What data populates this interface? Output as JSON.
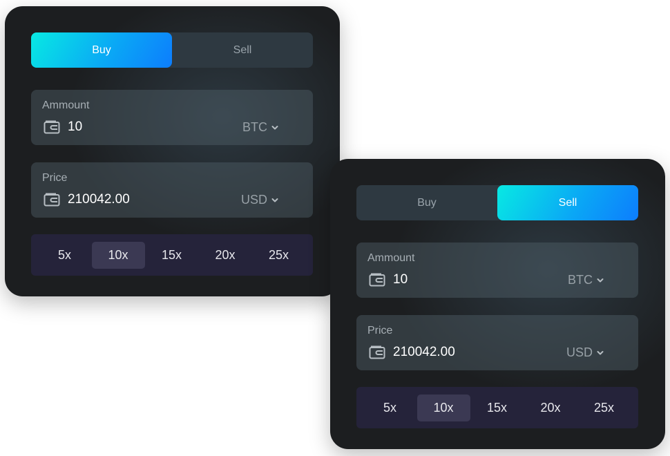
{
  "cards": [
    {
      "tabs": {
        "buy": "Buy",
        "sell": "Sell",
        "active": "buy"
      },
      "amount": {
        "label": "Ammount",
        "value": "10",
        "currency": "BTC"
      },
      "price": {
        "label": "Price",
        "value": "210042.00",
        "currency": "USD"
      },
      "leverage": {
        "options": [
          "5x",
          "10x",
          "15x",
          "20x",
          "25x"
        ],
        "selected": "10x"
      }
    },
    {
      "tabs": {
        "buy": "Buy",
        "sell": "Sell",
        "active": "sell"
      },
      "amount": {
        "label": "Ammount",
        "value": "10",
        "currency": "BTC"
      },
      "price": {
        "label": "Price",
        "value": "210042.00",
        "currency": "USD"
      },
      "leverage": {
        "options": [
          "5x",
          "10x",
          "15x",
          "20x",
          "25x"
        ],
        "selected": "10x"
      }
    }
  ],
  "icons": {
    "field": "wallet-icon",
    "dropdown": "chevron-down-icon"
  },
  "colors": {
    "accent_start": "#08e9e3",
    "accent_end": "#0d7dfd",
    "card_bg": "#1c1e20"
  }
}
